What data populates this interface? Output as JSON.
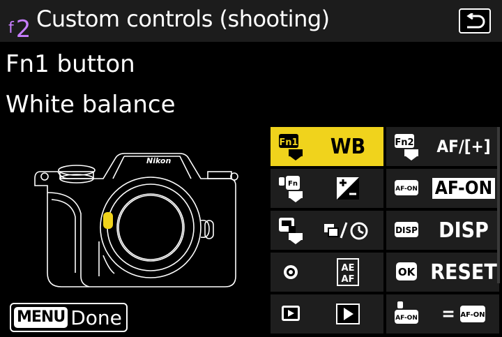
{
  "header": {
    "menu_letter": "f",
    "menu_number": "2",
    "title": "Custom controls (shooting)",
    "back_icon": "return-arrow-icon"
  },
  "selected": {
    "control_name": "Fn1 button",
    "assignment": "White balance"
  },
  "grid": {
    "cells": [
      {
        "icon": "fn1-button-icon",
        "value": "WB",
        "selected": true
      },
      {
        "icon": "fn2-button-icon",
        "value": "AF/[+]",
        "selected": false
      },
      {
        "icon": "fn-vertical-button-icon",
        "value": "",
        "selected": false
      },
      {
        "icon": "af-on-button-icon",
        "value": "AF-ON",
        "selected": false
      },
      {
        "icon": "fn-vertical-alt-icon",
        "value": "",
        "selected": false
      },
      {
        "icon": "disp-button-icon",
        "value": "DISP",
        "selected": false
      },
      {
        "icon": "sub-selector-center-icon",
        "value": "",
        "selected": false
      },
      {
        "icon": "ok-button-icon",
        "value": "RESET",
        "selected": false
      },
      {
        "icon": "playback-button-icon",
        "value": "",
        "selected": false
      },
      {
        "icon": "vertical-af-on-icon",
        "value": "=",
        "selected": false
      }
    ]
  },
  "footer": {
    "menu_badge": "MENU",
    "done_label": "Done"
  },
  "colors": {
    "accent": "#f0d31c",
    "menu_code": "#c77dff",
    "cell_bg": "#1e1e1e",
    "header_bg": "#1c1c1c"
  }
}
